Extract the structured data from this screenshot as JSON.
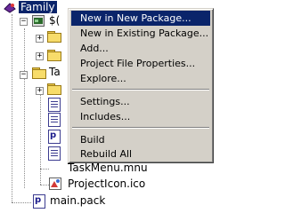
{
  "tree": {
    "root_label": "Family",
    "item1_label": "$(",
    "item2_label": "Ta",
    "task_menu_label": "TaskMenu.mnu",
    "project_icon_label": "ProjectIcon.ico",
    "main_pack_label": "main.pack"
  },
  "context_menu": {
    "items": [
      "New in New Package...",
      "New in Existing Package...",
      "Add...",
      "Project File Properties...",
      "Explore...",
      "Settings...",
      "Includes...",
      "Build",
      "Rebuild All"
    ],
    "highlighted_index": 0
  },
  "colors": {
    "selection": "#0a246a",
    "menu_face": "#d4d0c8",
    "folder": "#f7dc6a"
  },
  "icons": {
    "root": "family-project-icon",
    "folder": "folder-icon",
    "resource": "resource-icon",
    "file": "document-icon",
    "ico": "image-icon",
    "pack": "pack-file-icon"
  }
}
